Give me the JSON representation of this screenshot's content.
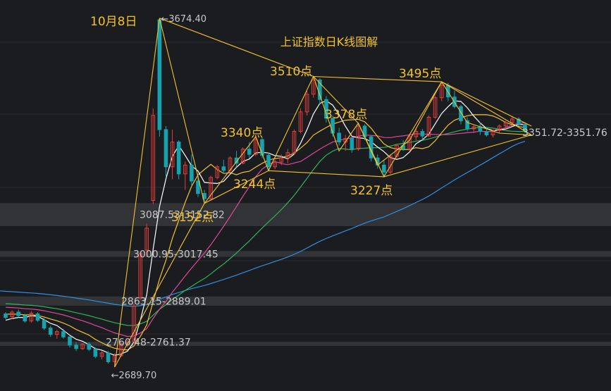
{
  "chart_data": {
    "type": "candlestick",
    "title": "上证指数日K线图解",
    "colors": {
      "up": "#e0403c",
      "down": "#17a3ad",
      "background": "#1b1c20",
      "gridline": "#2c2d31",
      "annotation": "#f2c12e",
      "ma5": "#ffffff",
      "ma10": "#f2c12e",
      "ma20": "#e0489a",
      "ma30": "#2fb45a",
      "ma60": "#2f8fe0",
      "price_text": "#c8c8c8"
    },
    "y_range_estimate": [
      2680,
      3690
    ],
    "extremes": [
      {
        "label": "←3674.40",
        "value": 3674.4
      },
      {
        "label": "←2689.70",
        "value": 2689.7
      }
    ],
    "gap_zones": [
      {
        "label": "3087.53-3152.82",
        "low": 3087.53,
        "high": 3152.82
      },
      {
        "label": "3000.95-3017.45",
        "low": 3000.95,
        "high": 3017.45
      },
      {
        "label": "2863.15-2889.01",
        "low": 2863.15,
        "high": 2889.01
      },
      {
        "label": "2760.48-2761.37",
        "low": 2760.48,
        "high": 2761.37
      },
      {
        "label": "3351.72-3351.76",
        "low": 3351.72,
        "high": 3351.76
      }
    ],
    "peak_labels": [
      {
        "text": "10月8日",
        "value": 3674.4
      },
      {
        "text": "3510点",
        "value": 3510
      },
      {
        "text": "3495点",
        "value": 3495
      },
      {
        "text": "3378点",
        "value": 3378
      },
      {
        "text": "3340点",
        "value": 3340
      }
    ],
    "trough_labels": [
      {
        "text": "3152点",
        "value": 3152
      },
      {
        "text": "3244点",
        "value": 3244
      },
      {
        "text": "3227点",
        "value": 3227
      }
    ],
    "candles": [
      [
        2840,
        2845,
        2825,
        2830
      ],
      [
        2832,
        2850,
        2825,
        2845
      ],
      [
        2845,
        2852,
        2830,
        2835
      ],
      [
        2835,
        2840,
        2815,
        2820
      ],
      [
        2820,
        2848,
        2815,
        2842
      ],
      [
        2840,
        2845,
        2818,
        2822
      ],
      [
        2822,
        2828,
        2795,
        2800
      ],
      [
        2800,
        2806,
        2775,
        2782
      ],
      [
        2782,
        2795,
        2770,
        2790
      ],
      [
        2790,
        2798,
        2770,
        2775
      ],
      [
        2775,
        2780,
        2745,
        2752
      ],
      [
        2752,
        2760,
        2735,
        2742
      ],
      [
        2742,
        2758,
        2738,
        2755
      ],
      [
        2755,
        2760,
        2735,
        2740
      ],
      [
        2740,
        2745,
        2715,
        2720
      ],
      [
        2720,
        2735,
        2712,
        2730
      ],
      [
        2730,
        2735,
        2700,
        2705
      ],
      [
        2705,
        2728,
        2690,
        2722
      ],
      [
        2722,
        2760,
        2718,
        2756
      ],
      [
        2756,
        2768,
        2745,
        2760
      ],
      [
        2762,
        2868,
        2760,
        2862
      ],
      [
        2885,
        3015,
        2880,
        3010
      ],
      [
        3020,
        3095,
        3000,
        3082
      ],
      [
        3160,
        3420,
        3150,
        3400
      ],
      [
        3670,
        3674.4,
        3340,
        3360
      ],
      [
        3360,
        3370,
        3225,
        3255
      ],
      [
        3255,
        3360,
        3220,
        3325
      ],
      [
        3325,
        3330,
        3220,
        3235
      ],
      [
        3235,
        3270,
        3190,
        3260
      ],
      [
        3260,
        3290,
        3200,
        3215
      ],
      [
        3215,
        3235,
        3170,
        3180
      ],
      [
        3180,
        3190,
        3152,
        3165
      ],
      [
        3165,
        3230,
        3160,
        3225
      ],
      [
        3225,
        3260,
        3220,
        3255
      ],
      [
        3255,
        3275,
        3235,
        3245
      ],
      [
        3245,
        3285,
        3240,
        3280
      ],
      [
        3280,
        3300,
        3255,
        3265
      ],
      [
        3265,
        3310,
        3262,
        3305
      ],
      [
        3305,
        3325,
        3280,
        3290
      ],
      [
        3290,
        3340,
        3285,
        3332
      ],
      [
        3332,
        3338,
        3280,
        3288
      ],
      [
        3288,
        3295,
        3244,
        3255
      ],
      [
        3255,
        3275,
        3248,
        3268
      ],
      [
        3268,
        3290,
        3260,
        3280
      ],
      [
        3280,
        3305,
        3265,
        3295
      ],
      [
        3295,
        3360,
        3290,
        3355
      ],
      [
        3355,
        3420,
        3350,
        3410
      ],
      [
        3410,
        3470,
        3400,
        3460
      ],
      [
        3460,
        3510,
        3450,
        3500
      ],
      [
        3500,
        3505,
        3430,
        3445
      ],
      [
        3445,
        3455,
        3380,
        3392
      ],
      [
        3392,
        3400,
        3340,
        3350
      ],
      [
        3350,
        3365,
        3315,
        3325
      ],
      [
        3325,
        3345,
        3300,
        3335
      ],
      [
        3335,
        3340,
        3295,
        3305
      ],
      [
        3305,
        3378,
        3300,
        3370
      ],
      [
        3370,
        3375,
        3330,
        3340
      ],
      [
        3340,
        3345,
        3270,
        3280
      ],
      [
        3280,
        3290,
        3250,
        3260
      ],
      [
        3260,
        3275,
        3227,
        3240
      ],
      [
        3240,
        3290,
        3235,
        3285
      ],
      [
        3285,
        3320,
        3280,
        3315
      ],
      [
        3315,
        3330,
        3300,
        3305
      ],
      [
        3305,
        3345,
        3300,
        3340
      ],
      [
        3340,
        3365,
        3330,
        3355
      ],
      [
        3355,
        3362,
        3330,
        3342
      ],
      [
        3342,
        3400,
        3340,
        3395
      ],
      [
        3395,
        3455,
        3390,
        3450
      ],
      [
        3450,
        3495,
        3440,
        3485
      ],
      [
        3485,
        3492,
        3440,
        3452
      ],
      [
        3452,
        3470,
        3420,
        3425
      ],
      [
        3425,
        3430,
        3375,
        3385
      ],
      [
        3385,
        3395,
        3355,
        3362
      ],
      [
        3362,
        3372,
        3350,
        3368
      ],
      [
        3368,
        3380,
        3345,
        3355
      ],
      [
        3355,
        3365,
        3340,
        3345
      ],
      [
        3345,
        3360,
        3338,
        3358
      ],
      [
        3358,
        3375,
        3350,
        3370
      ],
      [
        3370,
        3385,
        3365,
        3380
      ],
      [
        3380,
        3398,
        3370,
        3390
      ],
      [
        3390,
        3395,
        3370,
        3375
      ],
      [
        3375,
        3380,
        3352,
        3356
      ]
    ]
  }
}
